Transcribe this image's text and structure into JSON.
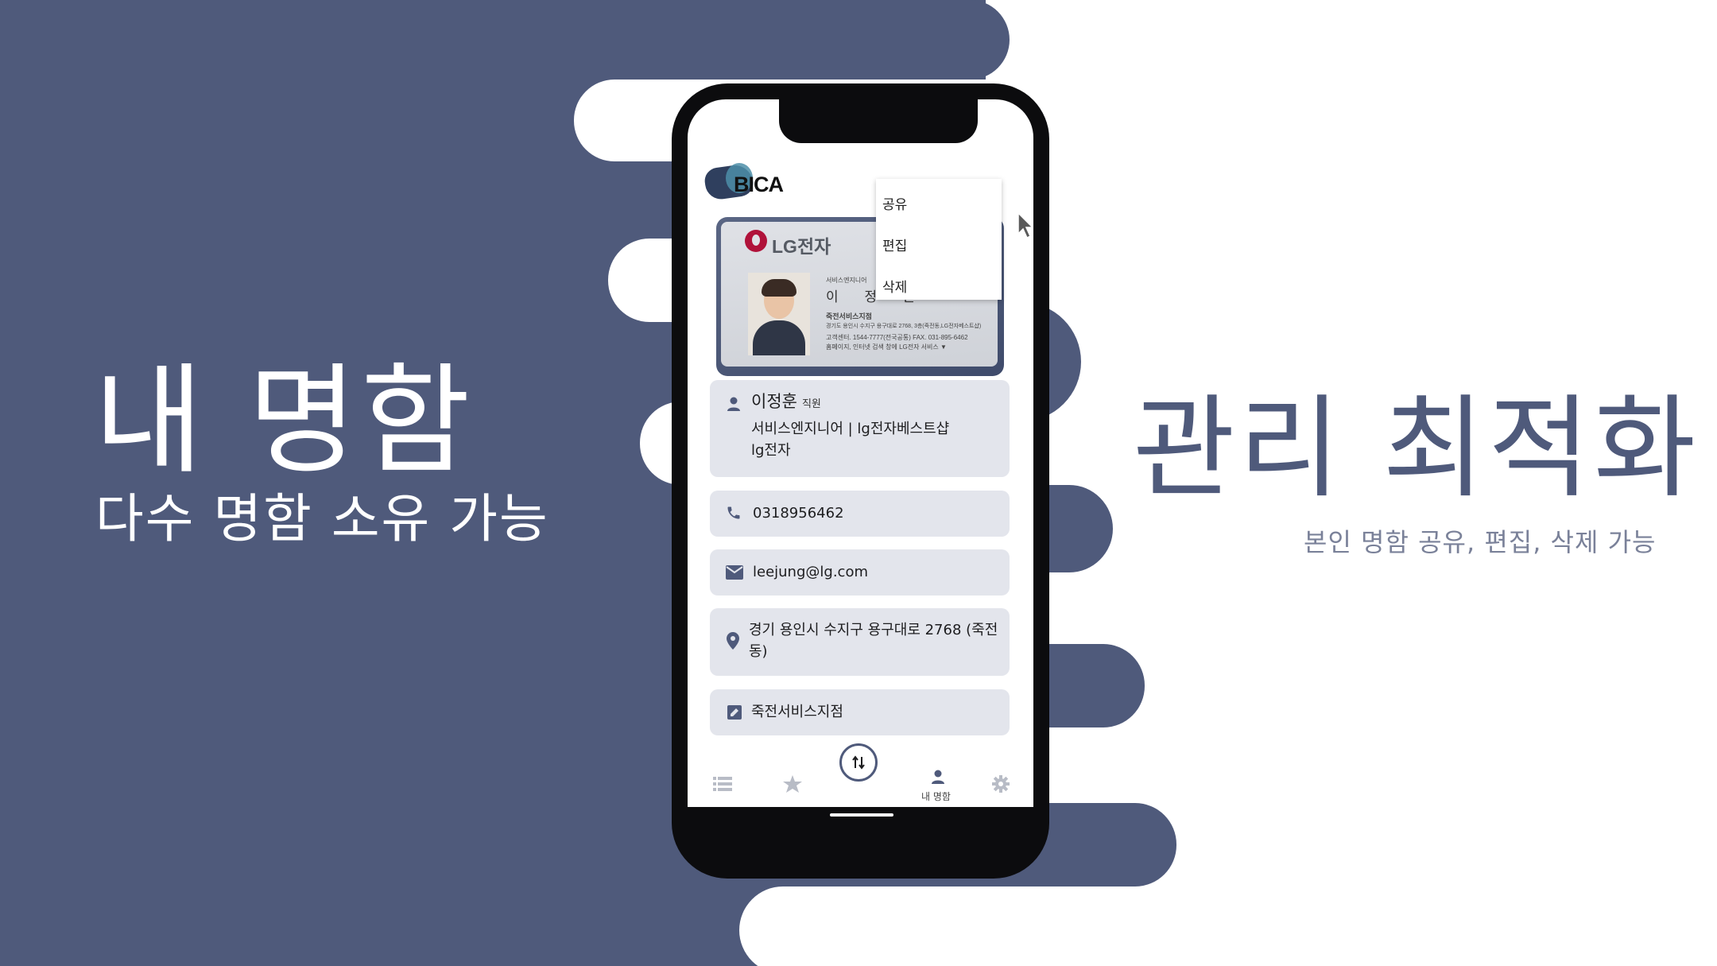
{
  "promo": {
    "left_title": "내 명함",
    "left_subtitle": "다수 명함 소유 가능",
    "right_title": "관리 최적화",
    "right_subtitle": "본인 명함 공유, 편집, 삭제 가능"
  },
  "colors": {
    "brand_navy": "#4f5a7b",
    "panel_bg": "#e3e5ec",
    "white": "#ffffff"
  },
  "app": {
    "logo_text": "BICA",
    "menu": {
      "items": [
        "공유",
        "편집",
        "삭제"
      ]
    },
    "card_image": {
      "brand": "LG전자",
      "dept_small": "서비스엔지니어",
      "name_spaced": "이 정 훈",
      "branch": "죽전서비스지점",
      "address_line": "경기도 용인시 수지구 용구대로 2768, 3층(죽전동,LG전자베스트샵)",
      "phone_line": "고객센터. 1544-7777(전국공통)  FAX. 031-895-6462",
      "web_line": "홈페이지, 인터넷 검색 창에  LG전자 서비스 ▼"
    },
    "profile": {
      "name": "이정훈",
      "title": "직원",
      "position_line": "서비스엔지니어 | lg전자베스트샵",
      "company": "lg전자",
      "phone": "0318956462",
      "email": "leejung@lg.com",
      "address": "경기 용인시 수지구 용구대로 2768 (죽전동)",
      "memo": "죽전서비스지점"
    },
    "nav": {
      "items": [
        {
          "icon": "list-icon",
          "label": ""
        },
        {
          "icon": "star-icon",
          "label": ""
        },
        {
          "icon": "swap-icon",
          "label": ""
        },
        {
          "icon": "person-icon",
          "label": "내 명함"
        },
        {
          "icon": "gear-icon",
          "label": ""
        }
      ],
      "active_index": 3
    }
  }
}
